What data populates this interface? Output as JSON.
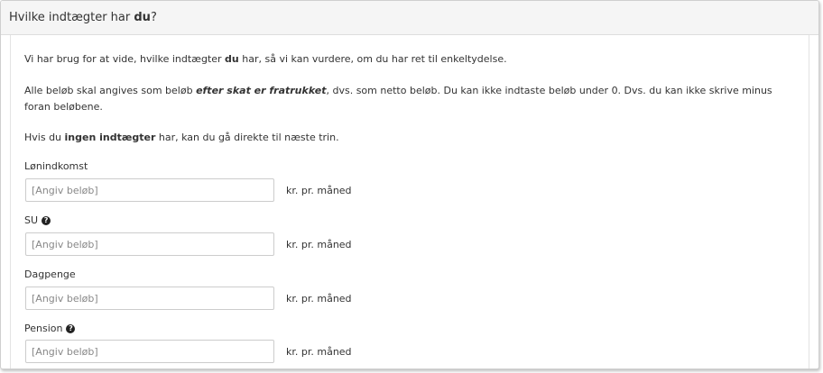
{
  "heading": {
    "prefix": "Hvilke indtægter har ",
    "bold": "du",
    "suffix": "?"
  },
  "intro": {
    "p1_before": "Vi har brug for at vide, hvilke indtægter ",
    "p1_bold": "du",
    "p1_after": " har, så vi kan vurdere, om du har ret til enkeltydelse.",
    "p2_before": "Alle beløb skal angives som beløb ",
    "p2_bold": "efter skat er fratrukket",
    "p2_after": ", dvs. som netto beløb. Du kan ikke indtaste beløb under 0. Dvs. du kan ikke skrive minus foran beløbene.",
    "p3_before": "Hvis du ",
    "p3_bold": "ingen indtægter",
    "p3_after": " har, kan du gå direkte til næste trin."
  },
  "fields": [
    {
      "label": "Lønindkomst",
      "help_icon": false,
      "placeholder": "[Angiv beløb]",
      "value": "",
      "unit": "kr. pr. måned"
    },
    {
      "label": "SU",
      "help_icon": true,
      "placeholder": "[Angiv beløb]",
      "value": "",
      "unit": "kr. pr. måned"
    },
    {
      "label": "Dagpenge",
      "help_icon": false,
      "placeholder": "[Angiv beløb]",
      "value": "",
      "unit": "kr. pr. måned"
    },
    {
      "label": "Pension",
      "help_icon": true,
      "placeholder": "[Angiv beløb]",
      "value": "",
      "unit": "kr. pr. måned"
    }
  ],
  "icons": {
    "help": "question-circle-icon"
  },
  "help_glyph": "?"
}
